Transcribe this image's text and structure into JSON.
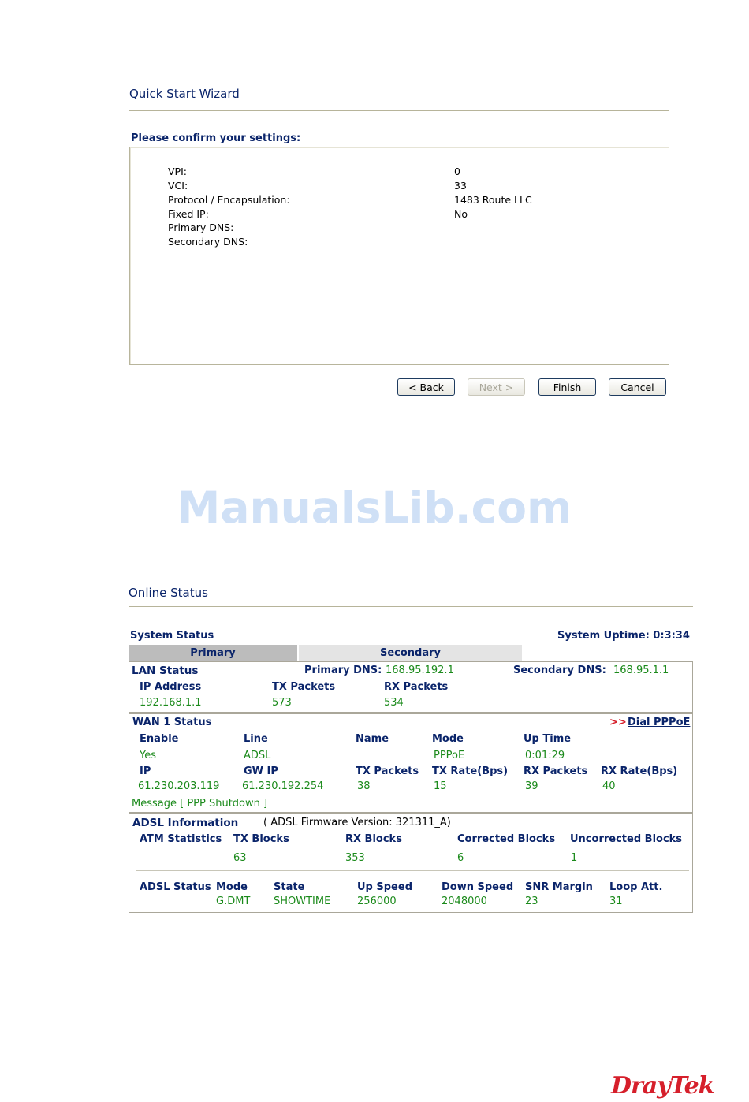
{
  "wizard": {
    "title": "Quick Start Wizard",
    "confirm_label": "Please confirm your settings:",
    "settings": [
      {
        "label": "VPI:",
        "value": "0"
      },
      {
        "label": "VCI:",
        "value": "33"
      },
      {
        "label": "Protocol / Encapsulation:",
        "value": "1483 Route LLC"
      },
      {
        "label": "Fixed IP:",
        "value": "No"
      },
      {
        "label": "Primary DNS:",
        "value": ""
      },
      {
        "label": "Secondary DNS:",
        "value": ""
      }
    ],
    "buttons": {
      "back": "< Back",
      "next": "Next >",
      "finish": "Finish",
      "cancel": "Cancel"
    }
  },
  "watermark": "ManualsLib.com",
  "online_status": {
    "title": "Online Status",
    "system_status": "System Status",
    "uptime_label": "System Uptime: 0:3:34",
    "tabs": {
      "primary": "Primary",
      "secondary": "Secondary"
    },
    "lan": {
      "heading": "LAN Status",
      "primary_dns_label": "Primary DNS:",
      "primary_dns": "168.95.192.1",
      "secondary_dns_label": "Secondary DNS:",
      "secondary_dns": "168.95.1.1",
      "headers": [
        "IP Address",
        "TX Packets",
        "RX Packets"
      ],
      "values": [
        "192.168.1.1",
        "573",
        "534"
      ]
    },
    "wan": {
      "heading": "WAN 1 Status",
      "dial_prefix": ">>",
      "dial_link": "Dial PPPoE",
      "headers1": [
        "Enable",
        "Line",
        "Name",
        "Mode",
        "Up Time"
      ],
      "values1": [
        "Yes",
        "ADSL",
        "",
        "PPPoE",
        "0:01:29"
      ],
      "headers2": [
        "IP",
        "GW IP",
        "TX Packets",
        "TX Rate(Bps)",
        "RX Packets",
        "RX Rate(Bps)"
      ],
      "values2": [
        "61.230.203.119",
        "61.230.192.254",
        "38",
        "15",
        "39",
        "40"
      ],
      "message": "Message [ PPP Shutdown ]"
    },
    "adsl": {
      "heading": "ADSL Information",
      "firmware": "( ADSL Firmware Version:   321311_A)",
      "atm_label": "ATM Statistics",
      "atm_headers": [
        "TX Blocks",
        "RX Blocks",
        "Corrected Blocks",
        "Uncorrected Blocks"
      ],
      "atm_values": [
        "63",
        "353",
        "6",
        "1"
      ],
      "status_label": "ADSL Status",
      "status_headers": [
        "Mode",
        "State",
        "Up Speed",
        "Down Speed",
        "SNR Margin",
        "Loop Att."
      ],
      "status_values": [
        "G.DMT",
        "SHOWTIME",
        "256000",
        "2048000",
        "23",
        "31"
      ]
    }
  },
  "brand": "DrayTek"
}
